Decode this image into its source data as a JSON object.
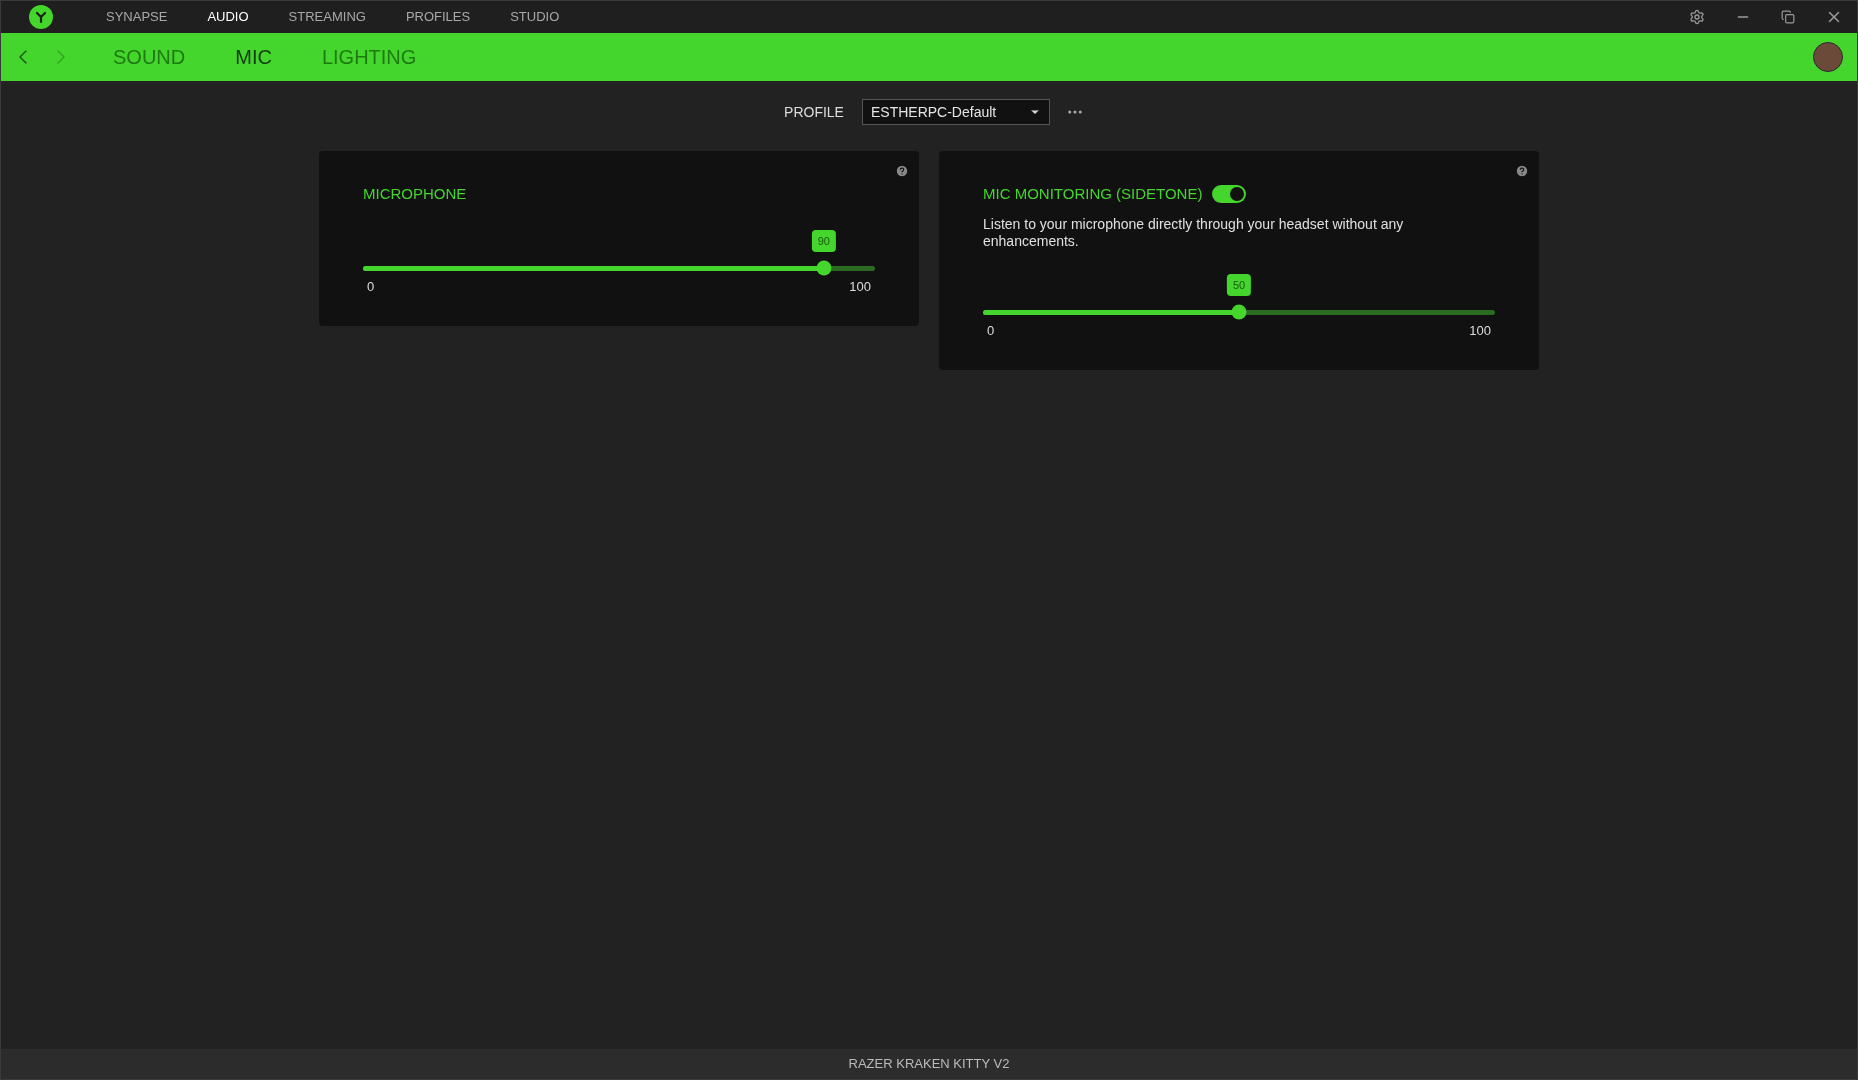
{
  "top_tabs": [
    {
      "label": "SYNAPSE",
      "selected": false
    },
    {
      "label": "AUDIO",
      "selected": true
    },
    {
      "label": "STREAMING",
      "selected": false
    },
    {
      "label": "PROFILES",
      "selected": false
    },
    {
      "label": "STUDIO",
      "selected": false
    }
  ],
  "sub_tabs": [
    {
      "label": "SOUND",
      "selected": false
    },
    {
      "label": "MIC",
      "selected": true
    },
    {
      "label": "LIGHTING",
      "selected": false
    }
  ],
  "profile": {
    "label": "PROFILE",
    "value": "ESTHERPC-Default"
  },
  "cards": [
    {
      "title": "MICROPHONE",
      "slider": {
        "level": 0.9,
        "value": "90",
        "min": "0",
        "max": "100"
      }
    },
    {
      "title": "MIC MONITORING (SIDETONE)",
      "toggle": {
        "on": true
      },
      "description": "Listen to your microphone directly through your headset without any enhancements.",
      "slider": {
        "level": 0.5,
        "value": "50",
        "min": "0",
        "max": "100"
      }
    }
  ],
  "status_bar": "RAZER KRAKEN KITTY V2"
}
